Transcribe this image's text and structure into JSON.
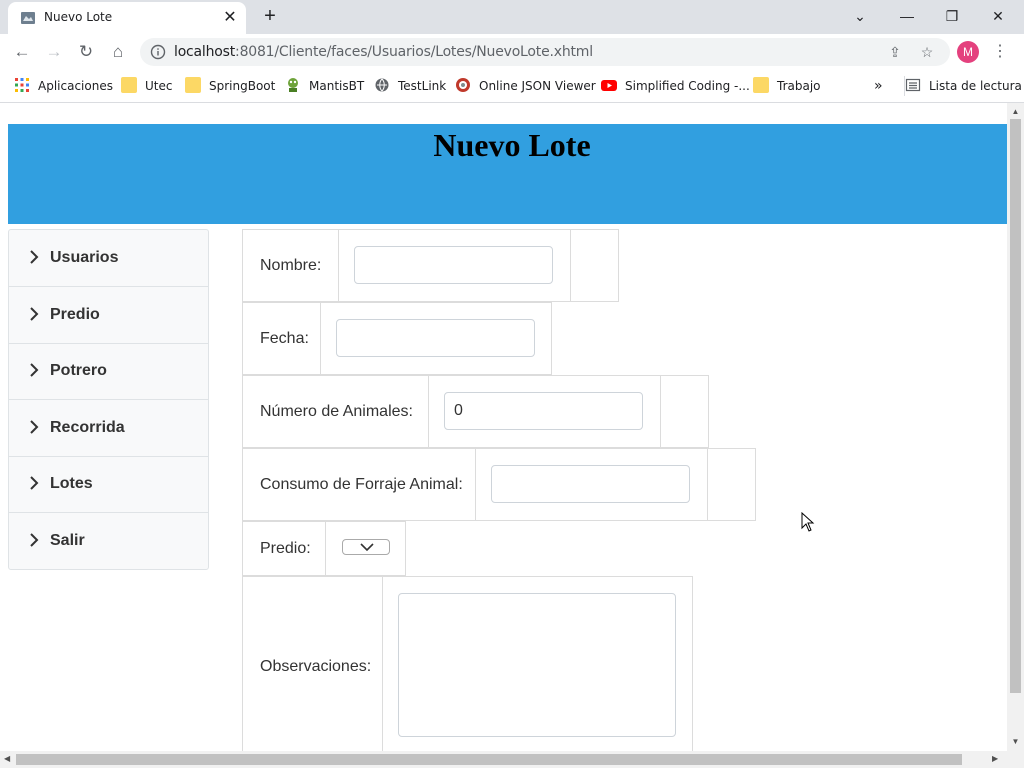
{
  "browser": {
    "tab_title": "Nuevo Lote",
    "url_host": "localhost",
    "url_path": ":8081/Cliente/faces/Usuarios/Lotes/NuevoLote.xhtml",
    "avatar_letter": "M",
    "bookmarks": [
      "Aplicaciones",
      "Utec",
      "SpringBoot",
      "MantisBT",
      "TestLink",
      "Online JSON Viewer",
      "Simplified Coding -...",
      "Trabajo"
    ],
    "overflow": "»",
    "reading_list": "Lista de lectura"
  },
  "page": {
    "title": "Nuevo Lote",
    "header_color": "#319fe0"
  },
  "sidebar": {
    "items": [
      {
        "label": "Usuarios"
      },
      {
        "label": "Predio"
      },
      {
        "label": "Potrero"
      },
      {
        "label": "Recorrida"
      },
      {
        "label": "Lotes"
      },
      {
        "label": "Salir"
      }
    ]
  },
  "form": {
    "nombre_label": "Nombre:",
    "nombre_value": "",
    "fecha_label": "Fecha:",
    "fecha_value": "",
    "animales_label": "Número de Animales:",
    "animales_value": "0",
    "forraje_label": "Consumo de Forraje Animal:",
    "forraje_value": "",
    "predio_label": "Predio:",
    "predio_value": "",
    "observaciones_label": "Observaciones:",
    "observaciones_value": ""
  }
}
